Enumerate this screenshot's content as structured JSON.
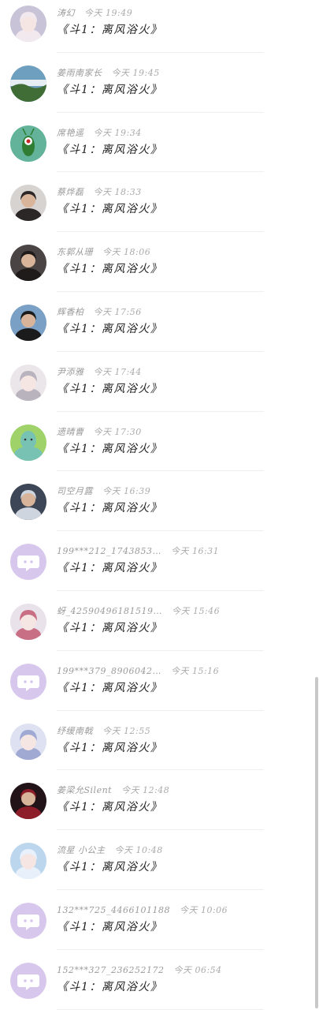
{
  "comments": [
    {
      "name": "涛幻",
      "time": "今天 19:49",
      "message": "《斗1：离风浴火》",
      "avatar": "anime-girl-avatar",
      "bg": "#c9c3d8",
      "fg": "#f2e9ef"
    },
    {
      "name": "姜雨南家长",
      "time": "今天 19:45",
      "message": "《斗1：离风浴火》",
      "avatar": "landscape-avatar",
      "bg": "#6f9fbf",
      "fg": "#3f6d35"
    },
    {
      "name": "席艳遥",
      "time": "今天 19:34",
      "message": "《斗1：离风浴火》",
      "avatar": "plankton-avatar",
      "bg": "#62b39a",
      "fg": "#2e7d32"
    },
    {
      "name": "蔡烨磊",
      "time": "今天 18:33",
      "message": "《斗1：离风浴火》",
      "avatar": "photo-avatar",
      "bg": "#d7d3d0",
      "fg": "#2b2727"
    },
    {
      "name": "东郭从珊",
      "time": "今天 18:06",
      "message": "《斗1：离风浴火》",
      "avatar": "photo-avatar",
      "bg": "#4a4444",
      "fg": "#1f1b1b"
    },
    {
      "name": "辉香柏",
      "time": "今天 17:56",
      "message": "《斗1：离风浴火》",
      "avatar": "photo-avatar",
      "bg": "#7aa0c6",
      "fg": "#1b1b1b"
    },
    {
      "name": "尹添雅",
      "time": "今天 17:44",
      "message": "《斗1：离风浴火》",
      "avatar": "anime-girl-avatar",
      "bg": "#ebe6ea",
      "fg": "#b9b3bd"
    },
    {
      "name": "遗晴曹",
      "time": "今天 17:30",
      "message": "《斗1：离风浴火》",
      "avatar": "cartoon-avatar",
      "bg": "#9fd36a",
      "fg": "#78c2b4"
    },
    {
      "name": "司空月露",
      "time": "今天 16:39",
      "message": "《斗1：离风浴火》",
      "avatar": "photo-avatar",
      "bg": "#3c4656",
      "fg": "#cfd5de"
    },
    {
      "name": "199***212_1743853…",
      "time": "今天 16:31",
      "message": "《斗1：离风浴火》",
      "avatar": "default-chat-avatar",
      "bg": "#d8c7ec",
      "fg": "#ffffff"
    },
    {
      "name": "蚜_42590496181519…",
      "time": "今天 15:46",
      "message": "《斗1：离风浴火》",
      "avatar": "anime-girl-avatar",
      "bg": "#e9e2ea",
      "fg": "#c86f85"
    },
    {
      "name": "199***379_8906042…",
      "time": "今天 15:16",
      "message": "《斗1：离风浴火》",
      "avatar": "default-chat-avatar",
      "bg": "#d8c7ec",
      "fg": "#ffffff"
    },
    {
      "name": "纾缓南戟",
      "time": "今天 12:55",
      "message": "《斗1：离风浴火》",
      "avatar": "anime-girl-avatar",
      "bg": "#dde1f1",
      "fg": "#9fa9d2"
    },
    {
      "name": "姜梁允Silent",
      "time": "今天 12:48",
      "message": "《斗1：离风浴火》",
      "avatar": "photo-avatar",
      "bg": "#221319",
      "fg": "#8e1d2a"
    },
    {
      "name": "流星 小公主",
      "time": "今天 10:48",
      "message": "《斗1：离风浴火》",
      "avatar": "anime-girl-avatar",
      "bg": "#bcd6ee",
      "fg": "#e8f1fb"
    },
    {
      "name": "132***725_4466101188",
      "time": "今天 10:06",
      "message": "《斗1：离风浴火》",
      "avatar": "default-chat-avatar",
      "bg": "#d8c7ec",
      "fg": "#ffffff"
    },
    {
      "name": "152***327_236252172",
      "time": "今天 06:54",
      "message": "《斗1：离风浴火》",
      "avatar": "default-chat-avatar",
      "bg": "#d8c7ec",
      "fg": "#ffffff"
    }
  ]
}
